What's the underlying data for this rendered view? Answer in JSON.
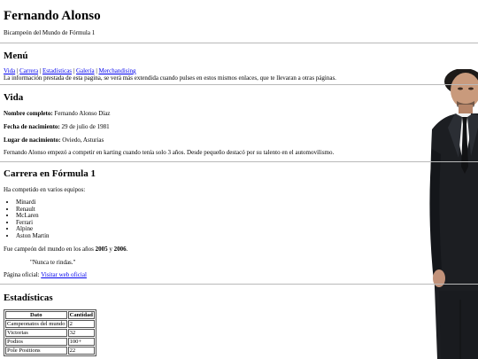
{
  "header": {
    "title": "Fernando Alonso",
    "subtitle": "Bicampeón del Mundo de Fórmula 1"
  },
  "menu": {
    "heading": "Menú",
    "links": [
      "Vida",
      "Carrera",
      "Estadísticas",
      "Galería",
      "Merchandising"
    ],
    "separator": " | ",
    "note": "La información prestada de esta pagina, se verá más extendida cuando pulses en estos mismos enlaces, que te llevaran a otras páginas."
  },
  "vida": {
    "heading": "Vida",
    "fields": [
      {
        "label": "Nombre completo:",
        "value": "Fernando Alonso Díaz"
      },
      {
        "label": "Fecha de nacimiento:",
        "value": "29 de julio de 1981"
      },
      {
        "label": "Lugar de nacimiento:",
        "value": "Oviedo, Asturias"
      }
    ],
    "bio": "Fernando Alonso empezó a competir en karting cuando tenía solo 3 años. Desde pequeño destacó por su talento en el automovilismo."
  },
  "carrera": {
    "heading": "Carrera en Fórmula 1",
    "intro": "Ha competido en varios equipos:",
    "teams": [
      "Minardi",
      "Renault",
      "McLaren",
      "Ferrari",
      "Alpine",
      "Aston Martin"
    ],
    "champion_prefix": "Fue campeón del mundo en los años ",
    "year1": "2005",
    "and": " y ",
    "year2": "2006",
    "period": ".",
    "quote": "\"Nunca te rindas.\"",
    "official_prefix": "Página oficial: ",
    "official_link": "Visitar web oficial"
  },
  "estadisticas": {
    "heading": "Estadísticas",
    "columns": [
      "Dato",
      "Cantidad"
    ],
    "rows": [
      [
        "Campeonatos del mundo",
        "2"
      ],
      [
        "Victorias",
        "32"
      ],
      [
        "Podios",
        "100+"
      ],
      [
        "Pole Positions",
        "22"
      ]
    ]
  },
  "colors": {
    "link": "#0000ee",
    "rule": "#b9b9b9"
  }
}
